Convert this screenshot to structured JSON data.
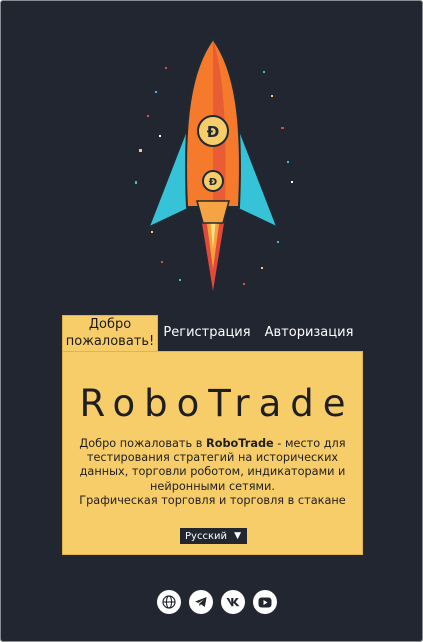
{
  "tabs": [
    {
      "label": "Добро пожаловать!",
      "active": true
    },
    {
      "label": "Регистрация",
      "active": false
    },
    {
      "label": "Авторизация",
      "active": false
    }
  ],
  "card": {
    "title": "RoboTrade",
    "desc_prefix": "Добро пожаловать в ",
    "desc_brand": "RoboTrade",
    "desc_rest": " - место для тестирования стратегий на исторических данных, торговли роботом, индикаторами и нейронными сетями.",
    "desc_line2": "Графическая торговля и торговля в стакане"
  },
  "language_select": {
    "value": "Русский"
  },
  "social_icons": [
    "globe-icon",
    "telegram-icon",
    "vk-icon",
    "youtube-icon"
  ],
  "colors": {
    "background": "#222631",
    "accent": "#f7cd6a",
    "text_dark": "#1f1f1f"
  }
}
